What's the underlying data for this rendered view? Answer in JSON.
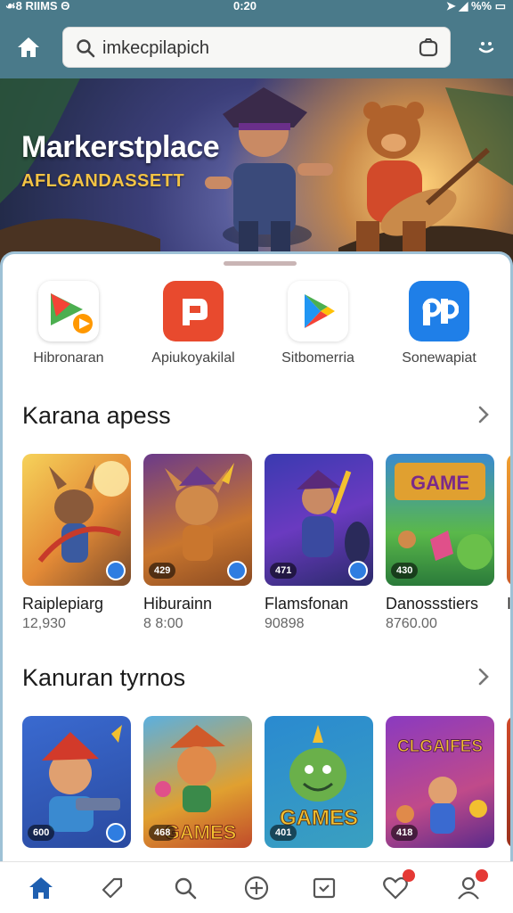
{
  "status_bar": {
    "left_text": "☙8 RIIMS Θ",
    "time": "0:20",
    "right_text": "➤ ◢ %% ▭"
  },
  "search": {
    "value": "imkecpilapich",
    "icon": "search-icon"
  },
  "banner": {
    "title": "Markerstplace",
    "subtitle": "AFLGANDASSETT"
  },
  "apps": [
    {
      "label": "Hibronaran",
      "icon": "colorful-play-icon",
      "color": "#ffffff"
    },
    {
      "label": "Apiukoyakilal",
      "icon": "red-p-icon",
      "color": "#e84a2e"
    },
    {
      "label": "Sitbomerria",
      "icon": "play-store-icon",
      "color": "#ffffff"
    },
    {
      "label": "Sonewapiat",
      "icon": "blue-p-icon",
      "color": "#1f7fe8"
    }
  ],
  "section1": {
    "title": "Karana apess",
    "cards": [
      {
        "title": "Raiplepiarg",
        "price": "12,930",
        "badge": ""
      },
      {
        "title": "Hiburainn",
        "price": "8 8:00",
        "badge": "429"
      },
      {
        "title": "Flamsfonan",
        "price": "90898",
        "badge": "471"
      },
      {
        "title": "Danossstiers",
        "price": "8760.00",
        "badge": "430"
      },
      {
        "title": "I",
        "price": "",
        "badge": ""
      }
    ]
  },
  "section2": {
    "title": "Kanuran tyrnos",
    "cards": [
      {
        "badge": "600"
      },
      {
        "badge": "468"
      },
      {
        "badge": "401"
      },
      {
        "badge": "418"
      }
    ],
    "art_text": {
      "card2": "GAMES",
      "card3": "GAMES",
      "card4": "CLGAIFES"
    }
  },
  "bottom_nav": [
    {
      "name": "home",
      "icon": "home-icon",
      "active": true
    },
    {
      "name": "tag",
      "icon": "tag-icon",
      "active": false
    },
    {
      "name": "search",
      "icon": "search-icon",
      "active": false
    },
    {
      "name": "add",
      "icon": "plus-circle-icon",
      "active": false
    },
    {
      "name": "inbox",
      "icon": "inbox-icon",
      "active": false
    },
    {
      "name": "favorites",
      "icon": "heart-icon",
      "active": false,
      "badge": true
    },
    {
      "name": "profile",
      "icon": "user-icon",
      "active": false,
      "badge": true
    }
  ],
  "colors": {
    "header": "#4a7a8a",
    "accent": "#1f5fb0",
    "badge": "#e53935"
  }
}
